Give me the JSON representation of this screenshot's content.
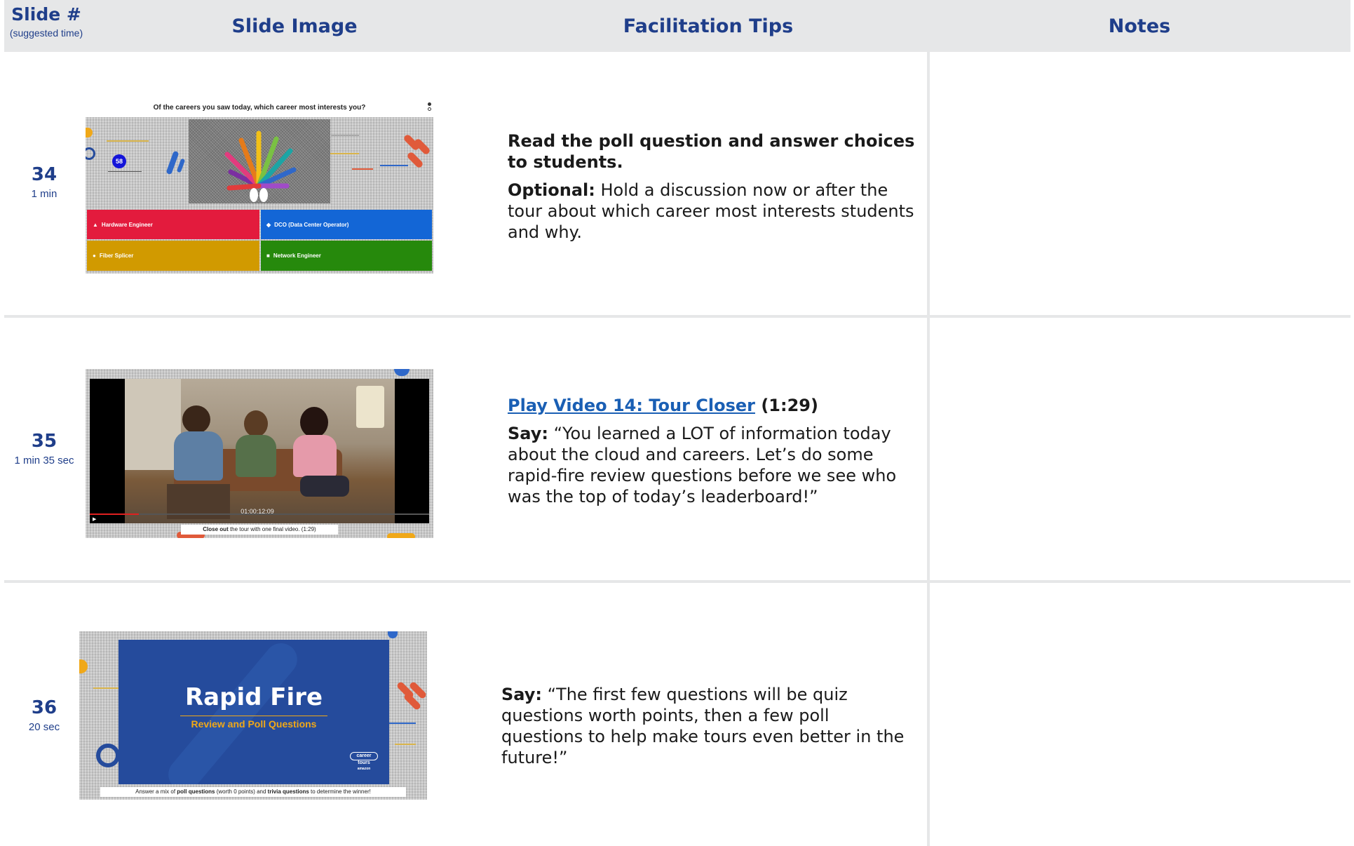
{
  "header": {
    "slide_title": "Slide #",
    "slide_sub": "(suggested time)",
    "image_title": "Slide Image",
    "tips_title": "Facilitation Tips",
    "notes_title": "Notes"
  },
  "rows": [
    {
      "number": "34",
      "duration": "1 min",
      "thumb": {
        "question": "Of the careers you saw today, which career most interests you?",
        "count": "58",
        "options": [
          "Hardware Engineer",
          "DCO (Data Center Operator)",
          "Fiber Splicer",
          "Network Engineer"
        ]
      },
      "tips": {
        "p1_bold": "Read the poll question and answer choices to students.",
        "p2_bold": "Optional:",
        "p2_text": " Hold a discussion now or after the tour about which career most interests students and why."
      }
    },
    {
      "number": "35",
      "duration": "1 min 35 sec",
      "thumb": {
        "timecode": "01:00:12:09",
        "caption_bold": "Close out",
        "caption_text": " the tour with one final video. (1:29)"
      },
      "tips": {
        "link": "Play Video 14: Tour Closer",
        "link_suffix": " (1:29)",
        "say_bold": "Say:",
        "say_text": " “You learned a LOT of information today about the cloud and careers. Let’s do some rapid-fire review questions before we see who was the top of today’s leaderboard!”"
      }
    },
    {
      "number": "36",
      "duration": "20 sec",
      "thumb": {
        "title": "Rapid Fire",
        "subtitle": "Review and Poll Questions",
        "badge_1": "career",
        "badge_2": "tours",
        "badge_3": "amazon",
        "caption_1": "Answer a mix of ",
        "caption_2": "poll questions",
        "caption_3": " (worth 0 points) and ",
        "caption_4": "trivia questions",
        "caption_5": " to determine the winner!"
      },
      "tips": {
        "say_bold": "Say:",
        "say_text": " “The first few questions will be quiz questions worth points, then a few poll questions to help make tours even better in the future!”"
      }
    }
  ],
  "colors": {
    "header_text": "#1f3e8a",
    "poll_red": "#e31b3d",
    "poll_blue": "#1366d6",
    "poll_yellow": "#d19a00",
    "poll_green": "#26890c",
    "rapid_blue": "#254b9c",
    "rapid_gold": "#f0a818"
  }
}
